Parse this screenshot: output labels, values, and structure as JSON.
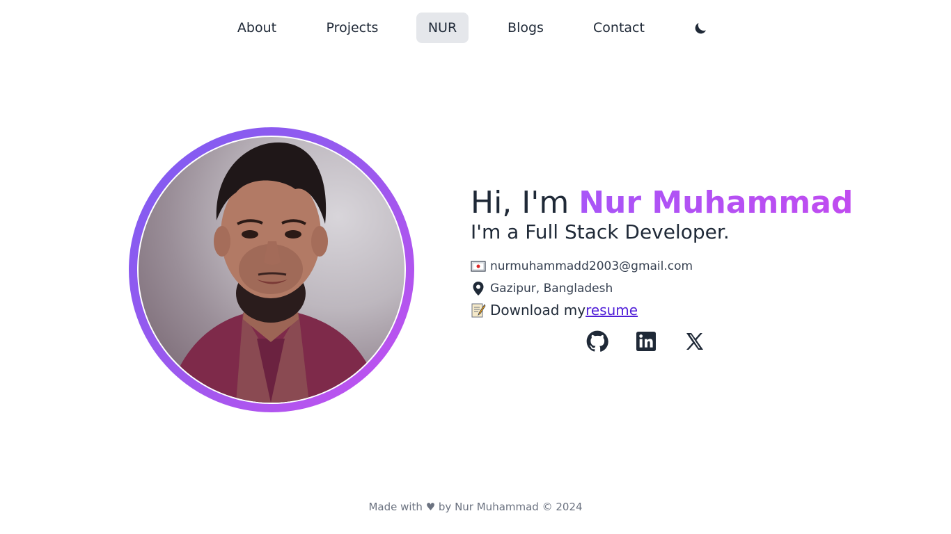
{
  "nav": {
    "items": [
      {
        "label": "About"
      },
      {
        "label": "Projects"
      },
      {
        "label": "NUR"
      },
      {
        "label": "Blogs"
      },
      {
        "label": "Contact"
      }
    ],
    "theme_toggle_icon": "moon-icon"
  },
  "hero": {
    "greeting_prefix": "Hi, I'm ",
    "name": "Nur Muhammad",
    "role": "I'm a Full Stack Developer.",
    "email": "nurmuhammadd2003@gmail.com",
    "location": "Gazipur, Bangladesh",
    "resume_prefix": "Download my",
    "resume_link": "resume",
    "avatar_ring_colors": [
      "#7c5cf2",
      "#c650f0"
    ],
    "name_gradient": [
      "#a855f7",
      "#c04cf0"
    ]
  },
  "social": [
    {
      "icon": "github-icon"
    },
    {
      "icon": "linkedin-icon"
    },
    {
      "icon": "x-icon"
    }
  ],
  "footer": {
    "text": "Made with ♥ by Nur Muhammad © 2024"
  }
}
